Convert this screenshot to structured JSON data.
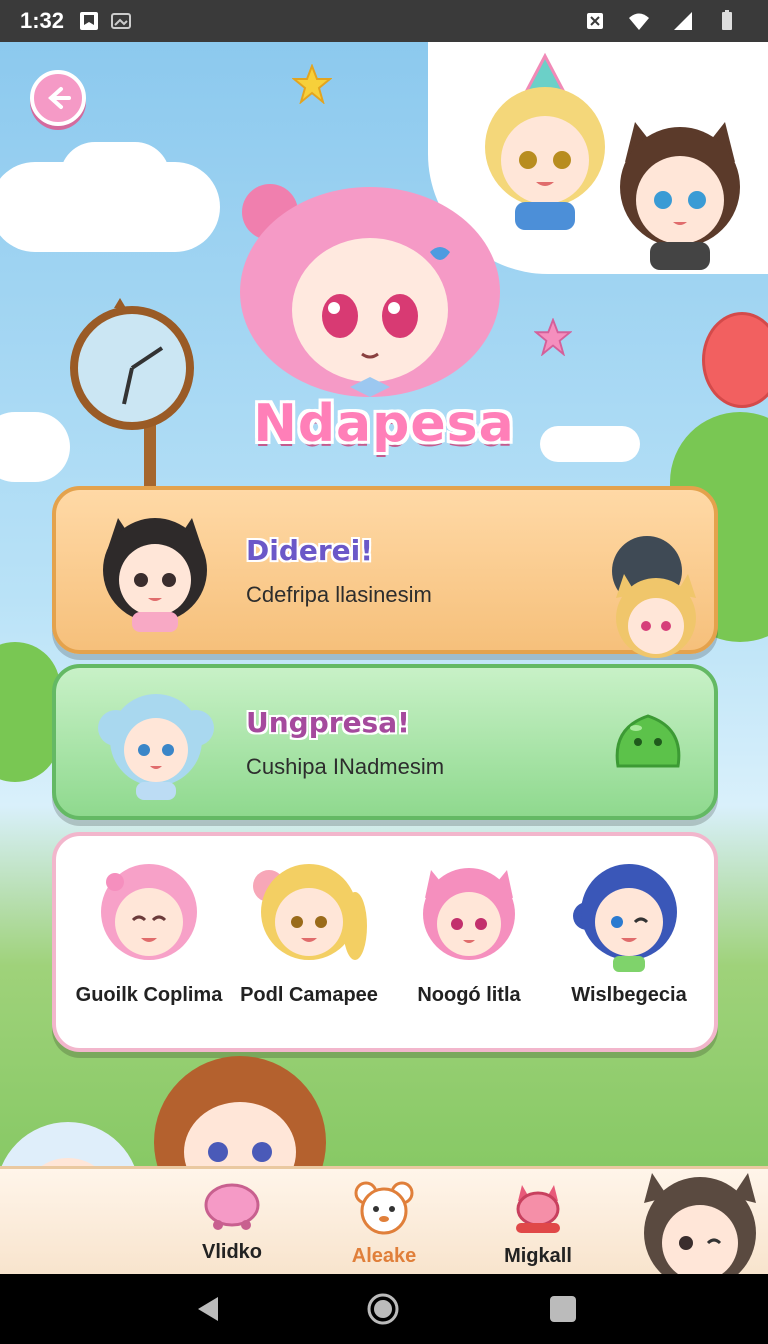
{
  "status_bar": {
    "time": "1:32"
  },
  "app": {
    "title": "Ndapesa"
  },
  "cards": [
    {
      "title": "Diderei!",
      "subtitle": "Cdefripa llasinesim",
      "accent": "#f6c07b"
    },
    {
      "title": "Ungpresa!",
      "subtitle": "Cushipa INadmesim",
      "accent": "#8fd98e"
    }
  ],
  "friends": [
    {
      "name": "Guoilk Coplima",
      "hair": "#f7a1c8"
    },
    {
      "name": "Podl Camapee",
      "hair": "#f3cf63"
    },
    {
      "name": "Noogó litla",
      "hair": "#f58fbe"
    },
    {
      "name": "Wislbegecia",
      "hair": "#3a57b8"
    }
  ],
  "bottom_nav": [
    {
      "label": "Vlidko",
      "icon": "pink-blob-icon"
    },
    {
      "label": "Aleake",
      "icon": "bear-face-icon",
      "active": true
    },
    {
      "label": "Migkall",
      "icon": "pink-cat-icon"
    }
  ],
  "colors": {
    "accent_pink": "#ff7fb8",
    "active_nav": "#e07f3a"
  }
}
